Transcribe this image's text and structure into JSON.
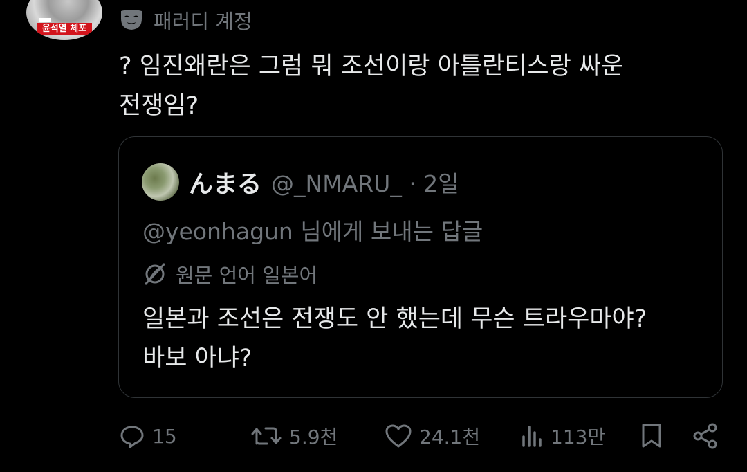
{
  "author_avatar": {
    "caption": "윤석열 체포"
  },
  "account_label": "패러디 계정",
  "post_text_lines": [
    "? 임진왜란은 그럼 뭐 조선이랑 아틀란티스랑 싸운",
    "전쟁임?"
  ],
  "quote": {
    "display_name": "んまる",
    "handle_time": "@_NMARU_ · 2일",
    "reply_to": "@yeonhagun 님에게 보내는 답글",
    "translation_note": "원문 언어 일본어",
    "body_lines": [
      "일본과 조선은 전쟁도 안 했는데 무슨 트라우마야?",
      "바보 아냐?"
    ]
  },
  "actions": {
    "replies": "15",
    "retweets": "5.9천",
    "likes": "24.1천",
    "views": "113만"
  },
  "icons": [
    "parody-mask-icon",
    "translate-icon",
    "reply-icon",
    "retweet-icon",
    "like-icon",
    "views-icon",
    "bookmark-icon",
    "share-icon"
  ],
  "colors": {
    "background": "#000000",
    "text": "#e7e9ea",
    "muted": "#71767b",
    "border": "#2f3336",
    "badge": "#d2141c"
  }
}
